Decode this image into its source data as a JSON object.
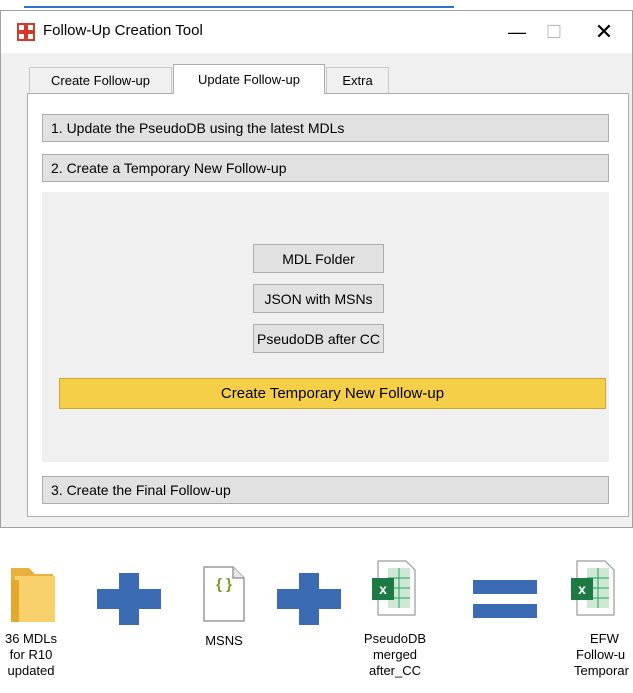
{
  "window": {
    "title": "Follow-Up Creation Tool",
    "controls": {
      "minimize": "—",
      "maximize": "☐",
      "close": "✕"
    }
  },
  "tabs": [
    "Create Follow-up",
    "Update Follow-up",
    "Extra"
  ],
  "active_tab": "Update Follow-up",
  "sections": {
    "s1": "1. Update the PseudoDB using the latest MDLs",
    "s2": "2. Create a Temporary New Follow-up",
    "s3": "3. Create the Final Follow-up"
  },
  "inputs": {
    "mdl": "MDL Folder",
    "json": "JSON with MSNs",
    "pseudodb": "PseudoDB after CC"
  },
  "create_button": "Create Temporary New Follow-up",
  "create_button_color": "#f6cf48",
  "diagram": {
    "folder": {
      "icon": "folder-icon",
      "lines": [
        "36 MDLs",
        "for R10",
        "updated"
      ]
    },
    "json": {
      "icon": "json-file-icon",
      "glyph": "{ }",
      "lines": [
        "MSNS"
      ]
    },
    "excel1": {
      "icon": "excel-file-icon",
      "letter": "x",
      "lines": [
        "PseudoDB",
        "merged",
        "after_CC"
      ]
    },
    "excel2": {
      "icon": "excel-file-icon",
      "letter": "x",
      "lines": [
        "EFW",
        "Follow-u",
        "Temporar"
      ]
    },
    "operator_color": "#3b6cb3"
  }
}
